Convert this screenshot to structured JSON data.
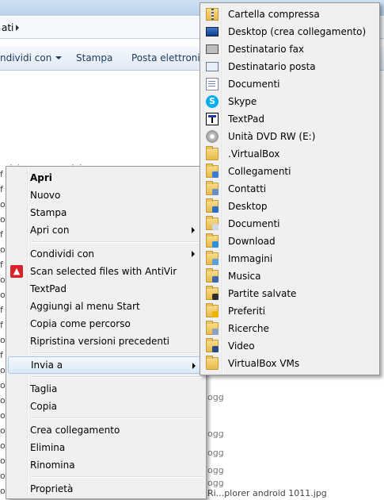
{
  "explorer": {
    "breadcrumb": "ati",
    "toolbar": {
      "share_label": "ndividi con",
      "print_label": "Stampa",
      "email_label": "Posta elettronica"
    },
    "file_fragments": [
      "f",
      "f",
      "ot",
      "ot",
      "f",
      "ot",
      "f",
      "ot",
      "ot",
      "f",
      "f",
      "ot",
      "f",
      "ot",
      "ot",
      "ot",
      "ot",
      "ot",
      "ot",
      "ot",
      "ot",
      "ot"
    ],
    "bottom_file": "Ri...plorer android 1011.jpg",
    "behind_menu_text": [
      "rivings roor - wixiu.ogg",
      "ogg",
      "ogg",
      "ogg",
      "ogg",
      "ogg"
    ]
  },
  "context_menu": {
    "items": [
      {
        "label": "Apri",
        "bold": true
      },
      {
        "label": "Nuovo"
      },
      {
        "label": "Stampa"
      },
      {
        "label": "Apri con",
        "submenu": true
      },
      {
        "separator": true
      },
      {
        "label": "Condividi con",
        "submenu": true
      },
      {
        "label": "Scan selected files with AntiVir",
        "icon": "antivir-icon"
      },
      {
        "label": "TextPad"
      },
      {
        "label": "Aggiungi al menu Start"
      },
      {
        "label": "Copia come percorso"
      },
      {
        "label": "Ripristina versioni precedenti"
      },
      {
        "separator": true
      },
      {
        "label": "Invia a",
        "submenu": true,
        "highlighted": true
      },
      {
        "separator": true
      },
      {
        "label": "Taglia"
      },
      {
        "label": "Copia"
      },
      {
        "separator": true
      },
      {
        "label": "Crea collegamento"
      },
      {
        "label": "Elimina"
      },
      {
        "label": "Rinomina"
      },
      {
        "separator": true
      },
      {
        "label": "Proprietà"
      }
    ]
  },
  "send_to_menu": {
    "items": [
      {
        "label": "Cartella compressa",
        "icon": "zip-folder-icon"
      },
      {
        "label": "Desktop (crea collegamento)",
        "icon": "desktop-icon"
      },
      {
        "label": "Destinatario fax",
        "icon": "fax-icon"
      },
      {
        "label": "Destinatario posta",
        "icon": "mail-icon"
      },
      {
        "label": "Documenti",
        "icon": "documents-icon"
      },
      {
        "label": "Skype",
        "icon": "skype-icon"
      },
      {
        "label": "TextPad",
        "icon": "textpad-icon"
      },
      {
        "label": "Unità DVD RW (E:)",
        "icon": "dvd-drive-icon"
      },
      {
        "label": ".VirtualBox",
        "icon": "folder-icon"
      },
      {
        "label": "Collegamenti",
        "icon": "links-folder-icon"
      },
      {
        "label": "Contatti",
        "icon": "contacts-folder-icon"
      },
      {
        "label": "Desktop",
        "icon": "desktop-folder-icon"
      },
      {
        "label": "Documenti",
        "icon": "documents-folder-icon"
      },
      {
        "label": "Download",
        "icon": "download-folder-icon"
      },
      {
        "label": "Immagini",
        "icon": "pictures-folder-icon"
      },
      {
        "label": "Musica",
        "icon": "music-folder-icon"
      },
      {
        "label": "Partite salvate",
        "icon": "saved-games-folder-icon"
      },
      {
        "label": "Preferiti",
        "icon": "favorites-folder-icon"
      },
      {
        "label": "Ricerche",
        "icon": "searches-folder-icon"
      },
      {
        "label": "Video",
        "icon": "videos-folder-icon"
      },
      {
        "label": "VirtualBox VMs",
        "icon": "folder-icon"
      }
    ]
  },
  "colors": {
    "menu_bg": "#f0f0f0",
    "highlight": "#dbe9f8",
    "antivir_red": "#d8232a",
    "skype_blue": "#00aff0"
  }
}
